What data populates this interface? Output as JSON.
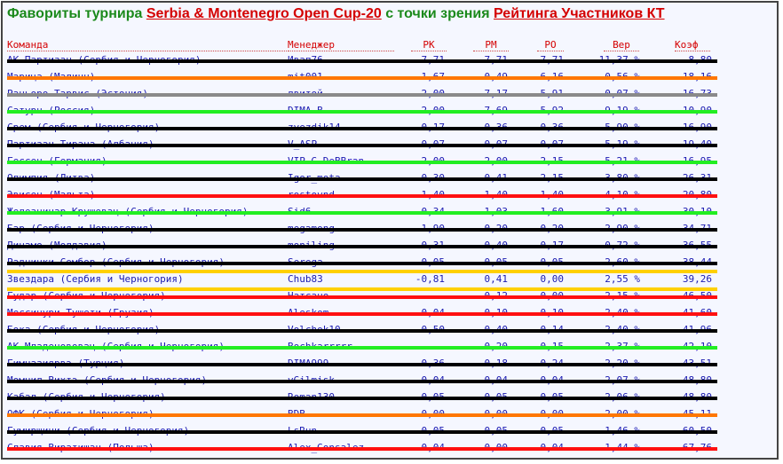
{
  "title": {
    "part1": "Фавориты турнира ",
    "tournament": "Serbia & Montenegro Open Cup-20",
    "part2": " с точки зрения ",
    "rating": "Рейтинга Участников КТ"
  },
  "colors": {
    "black": "#000000",
    "orange": "#ff7700",
    "gray": "#8a8a8a",
    "green": "#22ee22",
    "red": "#ff1010",
    "yellow": "#ffd000"
  },
  "headers": {
    "team": "Команда",
    "manager": "Менеджер",
    "pk": "РК",
    "pm": "РМ",
    "po": "РО",
    "ver": "Вер",
    "koef": "Коэф"
  },
  "rows": [
    {
      "team": "АК Партизан (Сербия и Черногория)",
      "manager": "Ивап76",
      "pk": "7,71",
      "pm": "7,71",
      "po": "7,71",
      "ver": "11,37 %",
      "koef": "8,80",
      "strike": "black"
    },
    {
      "team": "Марица (Малинн)",
      "manager": "mit001",
      "pk": "1,67",
      "pm": "0,49",
      "po": "6,16",
      "ver": "0,56 %",
      "koef": "18,16",
      "strike": "orange"
    },
    {
      "team": "Раньоро Тарвис (Эстония)",
      "manager": "лвитой",
      "pk": "2,00",
      "pm": "7,17",
      "po": "5,91",
      "ver": "0,07 %",
      "koef": "16,73",
      "strike": "gray"
    },
    {
      "team": "Сатурн (Россия)",
      "manager": "DIMA-B",
      "pk": "2,00",
      "pm": "7,69",
      "po": "5,92",
      "ver": "9,19 %",
      "koef": "10,90",
      "strike": "green"
    },
    {
      "team": "Срем (Сербия и Черногория)",
      "manager": "zvezdik14",
      "pk": "0,17",
      "pm": "0,36",
      "po": "0,36",
      "ver": "5,90 %",
      "koef": "16,90",
      "strike": "black"
    },
    {
      "team": "Партизан Тирана (Албания)",
      "manager": "V_ASP",
      "pk": "0,07",
      "pm": "0,07",
      "po": "0,07",
      "ver": "5,19 %",
      "koef": "19,40",
      "strike": "black"
    },
    {
      "team": "Гессен (Германия)",
      "manager": "VIP-G-DeBBran",
      "pk": "2,00",
      "pm": "2,00",
      "po": "2,15",
      "ver": "5,21 %",
      "koef": "16,95",
      "strike": "green"
    },
    {
      "team": "Олимпия (Литва)",
      "manager": "Igor_mota",
      "pk": "0,30",
      "pm": "0,41",
      "po": "2,15",
      "ver": "3,80 %",
      "koef": "26,31",
      "strike": "black"
    },
    {
      "team": "Эвисен (Мальта)",
      "manager": "rostovnd",
      "pk": "1,40",
      "pm": "1,40",
      "po": "1,40",
      "ver": "4,10 %",
      "koef": "20,80",
      "strike": "red"
    },
    {
      "team": "Железничар Крушевац (Сербия и Черногория)",
      "manager": "Sid6",
      "pk": "0,34",
      "pm": "1,03",
      "po": "1,60",
      "ver": "3,91 %",
      "koef": "30,10",
      "strike": "green"
    },
    {
      "team": "Бар (Сербия и Черногория)",
      "manager": "megamong",
      "pk": "1,90",
      "pm": "0,20",
      "po": "0,20",
      "ver": "2,90 %",
      "koef": "34,71",
      "strike": "black"
    },
    {
      "team": "Динамо (Молдавия)",
      "manager": "moniling",
      "pk": "0,31",
      "pm": "0,40",
      "po": "0,17",
      "ver": "0,72 %",
      "koef": "36,55",
      "strike": "black"
    },
    {
      "team": "Раднички Сомбор (Сербия и Черногория)",
      "manager": "Serega",
      "pk": "0,05",
      "pm": "0,05",
      "po": "0,05",
      "ver": "2,60 %",
      "koef": "38,44",
      "strike": "black"
    },
    {
      "team": "Звездара (Сербия и Черногория)",
      "manager": "Chub83",
      "pk": "-0,81",
      "pm": "0,41",
      "po": "0,00",
      "ver": "2,55 %",
      "koef": "39,26",
      "strike": "",
      "featured": true
    },
    {
      "team": "Гудар (Сербия и Черногория)",
      "manager": "Натсано",
      "pk": "",
      "pm": "0,12",
      "po": "0,00",
      "ver": "2,15 %",
      "koef": "46,50",
      "strike": "red"
    },
    {
      "team": "Мессинури Тушети (Грузия)",
      "manager": "Aleskom",
      "pk": "0,04",
      "pm": "0,10",
      "po": "0,10",
      "ver": "2,40 %",
      "koef": "41,60",
      "strike": "red"
    },
    {
      "team": "Бока (Сербия и Черногория)",
      "manager": "Volchok10",
      "pk": "0,50",
      "pm": "0,40",
      "po": "0,14",
      "ver": "2,40 %",
      "koef": "41,96",
      "strike": "black"
    },
    {
      "team": "АК Младенововац (Сербия и Черногория)",
      "manager": "Bochkarrrrr",
      "pk": "",
      "pm": "0,20",
      "po": "0,15",
      "ver": "2,37 %",
      "koef": "42,10",
      "strike": "green"
    },
    {
      "team": "Гимназиярвэ (Турция)",
      "manager": "DIMA999",
      "pk": "0,36",
      "pm": "0,18",
      "po": "0,24",
      "ver": "2,20 %",
      "koef": "43,51",
      "strike": "black"
    },
    {
      "team": "Момчил Вихтэ (Сербия и Черногория)",
      "manager": "vGilmisk",
      "pk": "0,04",
      "pm": "0,04",
      "po": "0,04",
      "ver": "2,07 %",
      "koef": "48,80",
      "strike": "black"
    },
    {
      "team": "Кабал (Сербия и Черногория)",
      "manager": "Roman130",
      "pk": "0,05",
      "pm": "0,05",
      "po": "0,05",
      "ver": "2,06 %",
      "koef": "48,80",
      "strike": "black"
    },
    {
      "team": "ОФК (Сербия и Черногория)",
      "manager": "BDB",
      "pk": "0,00",
      "pm": "0,00",
      "po": "0,00",
      "ver": "2,00 %",
      "koef": "45,11",
      "strike": "orange"
    },
    {
      "team": "Гумирщичи (Сербия и Черногория)",
      "manager": "LsRun",
      "pk": "0,05",
      "pm": "0,05",
      "po": "0,05",
      "ver": "1,46 %",
      "koef": "60,50",
      "strike": "black"
    },
    {
      "team": "Славия Виратишан (Польша)",
      "manager": "Alex_Gonsalez",
      "pk": "0,04",
      "pm": "0,00",
      "po": "0,04",
      "ver": "1,44 %",
      "koef": "67,76",
      "strike": "red"
    }
  ]
}
